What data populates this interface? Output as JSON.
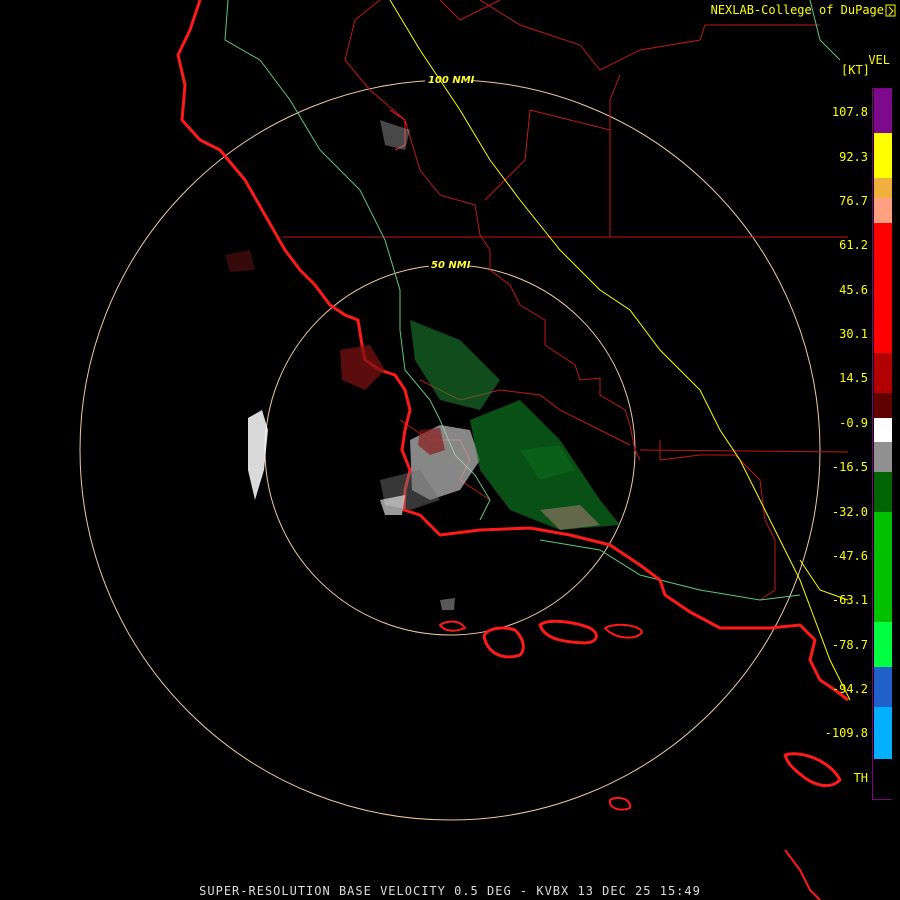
{
  "credit": "NEXLAB-College of DuPage",
  "product_footer": "SUPER-RESOLUTION BASE VELOCITY 0.5 DEG - KVBX 13 DEC 25 15:49",
  "legend": {
    "title": "VEL",
    "unit": "[KT]",
    "ticks": [
      "107.8",
      "92.3",
      "76.7",
      "61.2",
      "45.6",
      "30.1",
      "14.5",
      "-0.9",
      "-16.5",
      "-32.0",
      "-47.6",
      "-63.1",
      "-78.7",
      "-94.2",
      "-109.8",
      "TH"
    ],
    "scale": [
      {
        "color": "#7d0a8c"
      },
      {
        "color": "#ffff00"
      },
      {
        "color": "#f0b040"
      },
      {
        "color": "#ffa080"
      },
      {
        "color": "#ff0000"
      },
      {
        "color": "#b00000"
      },
      {
        "color": "#600000"
      },
      {
        "color": "#ffffff"
      },
      {
        "color": "#909090"
      },
      {
        "color": "#006400"
      },
      {
        "color": "#00c000"
      },
      {
        "color": "#00ff40"
      },
      {
        "color": "#2060c8"
      },
      {
        "color": "#00b0ff"
      },
      {
        "color": "#000000"
      }
    ]
  },
  "range_rings": [
    {
      "label": "50 NMI"
    },
    {
      "label": "100 NMI"
    }
  ],
  "colors": {
    "coastline": "#ff1a1a",
    "county_border": "#c01818",
    "highway_yellow": "#ffff00",
    "highway_green": "#5ec87a",
    "range_ring": "#f0c8a0",
    "text": "#ffff00",
    "footer_text": "#dcdcdc"
  }
}
